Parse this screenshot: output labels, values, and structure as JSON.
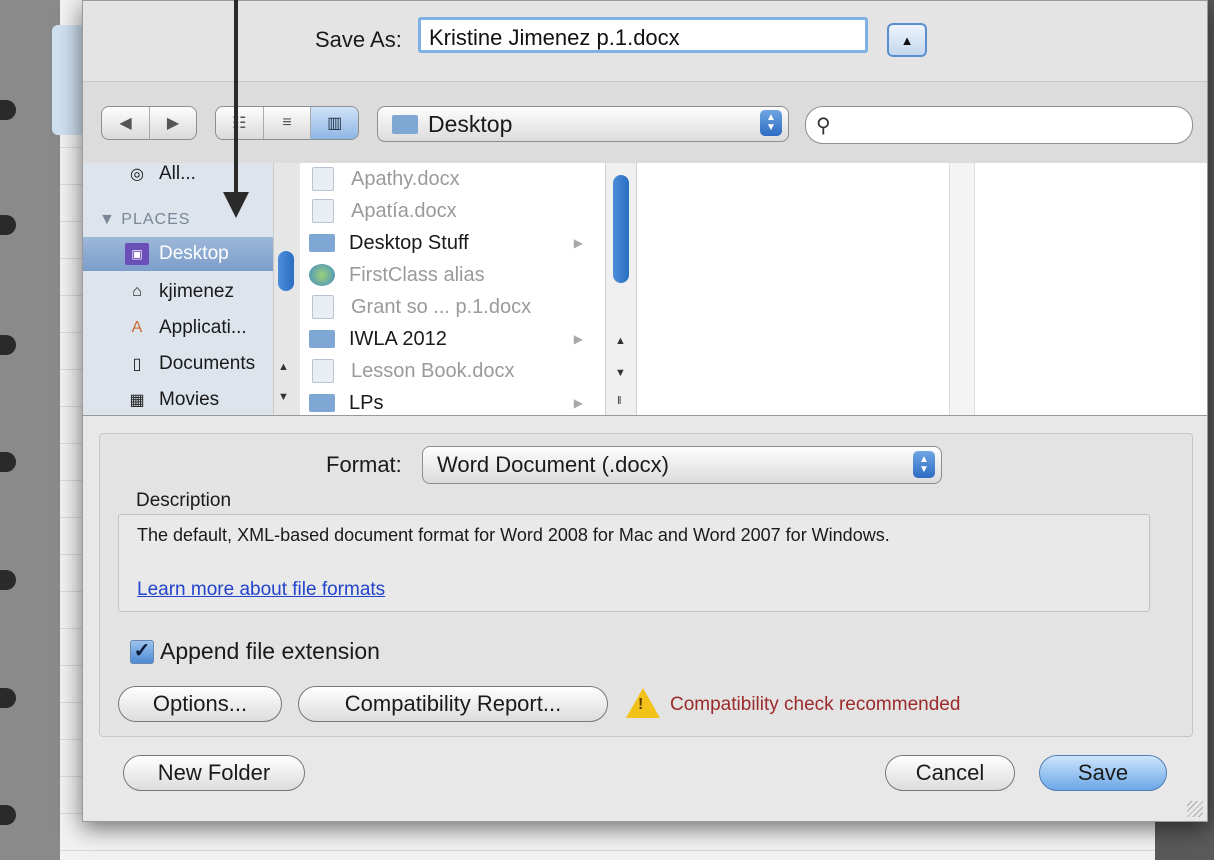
{
  "save_as": {
    "label": "Save As:",
    "filename": "Kristine Jimenez p.1.docx",
    "expand_icon": "triangle-up-icon"
  },
  "toolbar": {
    "nav": [
      "◀",
      "▶"
    ],
    "views": [
      "☷",
      "≡",
      "▥"
    ],
    "location": "Desktop",
    "search_placeholder": ""
  },
  "sidebar": {
    "all": "All...",
    "places_header": "▼ PLACES",
    "items": [
      {
        "label": "Desktop",
        "icon": "desktop-icon",
        "selected": true
      },
      {
        "label": "kjimenez",
        "icon": "home-icon"
      },
      {
        "label": "Applicati...",
        "icon": "applications-icon"
      },
      {
        "label": "Documents",
        "icon": "documents-icon"
      },
      {
        "label": "Movies",
        "icon": "movies-icon"
      }
    ]
  },
  "files": [
    {
      "name": "Apathy.docx",
      "kind": "doc",
      "enabled": false
    },
    {
      "name": "Apatía.docx",
      "kind": "doc",
      "enabled": false
    },
    {
      "name": "Desktop Stuff",
      "kind": "folder",
      "enabled": true,
      "has_children": true
    },
    {
      "name": "FirstClass alias",
      "kind": "alias",
      "enabled": false
    },
    {
      "name": "Grant so ... p.1.docx",
      "kind": "doc",
      "enabled": false
    },
    {
      "name": "IWLA 2012",
      "kind": "folder",
      "enabled": true,
      "has_children": true
    },
    {
      "name": "Lesson Book.docx",
      "kind": "doc",
      "enabled": false
    },
    {
      "name": "LPs",
      "kind": "folder",
      "enabled": true,
      "has_children": true
    }
  ],
  "format": {
    "label": "Format:",
    "value": "Word Document (.docx)"
  },
  "description": {
    "label": "Description",
    "text": "The default, XML-based document format for Word 2008 for Mac and Word 2007 for Windows.",
    "link": "Learn more about file formats"
  },
  "append_extension": {
    "label": "Append file extension",
    "checked": true
  },
  "buttons": {
    "options": "Options...",
    "compat_report": "Compatibility Report...",
    "new_folder": "New Folder",
    "cancel": "Cancel",
    "save": "Save"
  },
  "warning": {
    "text": "Compatibility check recommended",
    "icon": "warning-icon",
    "color": "#9c2a2a"
  },
  "colors": {
    "accent": "#2c6cc2",
    "selection": "#7c9ecb"
  }
}
